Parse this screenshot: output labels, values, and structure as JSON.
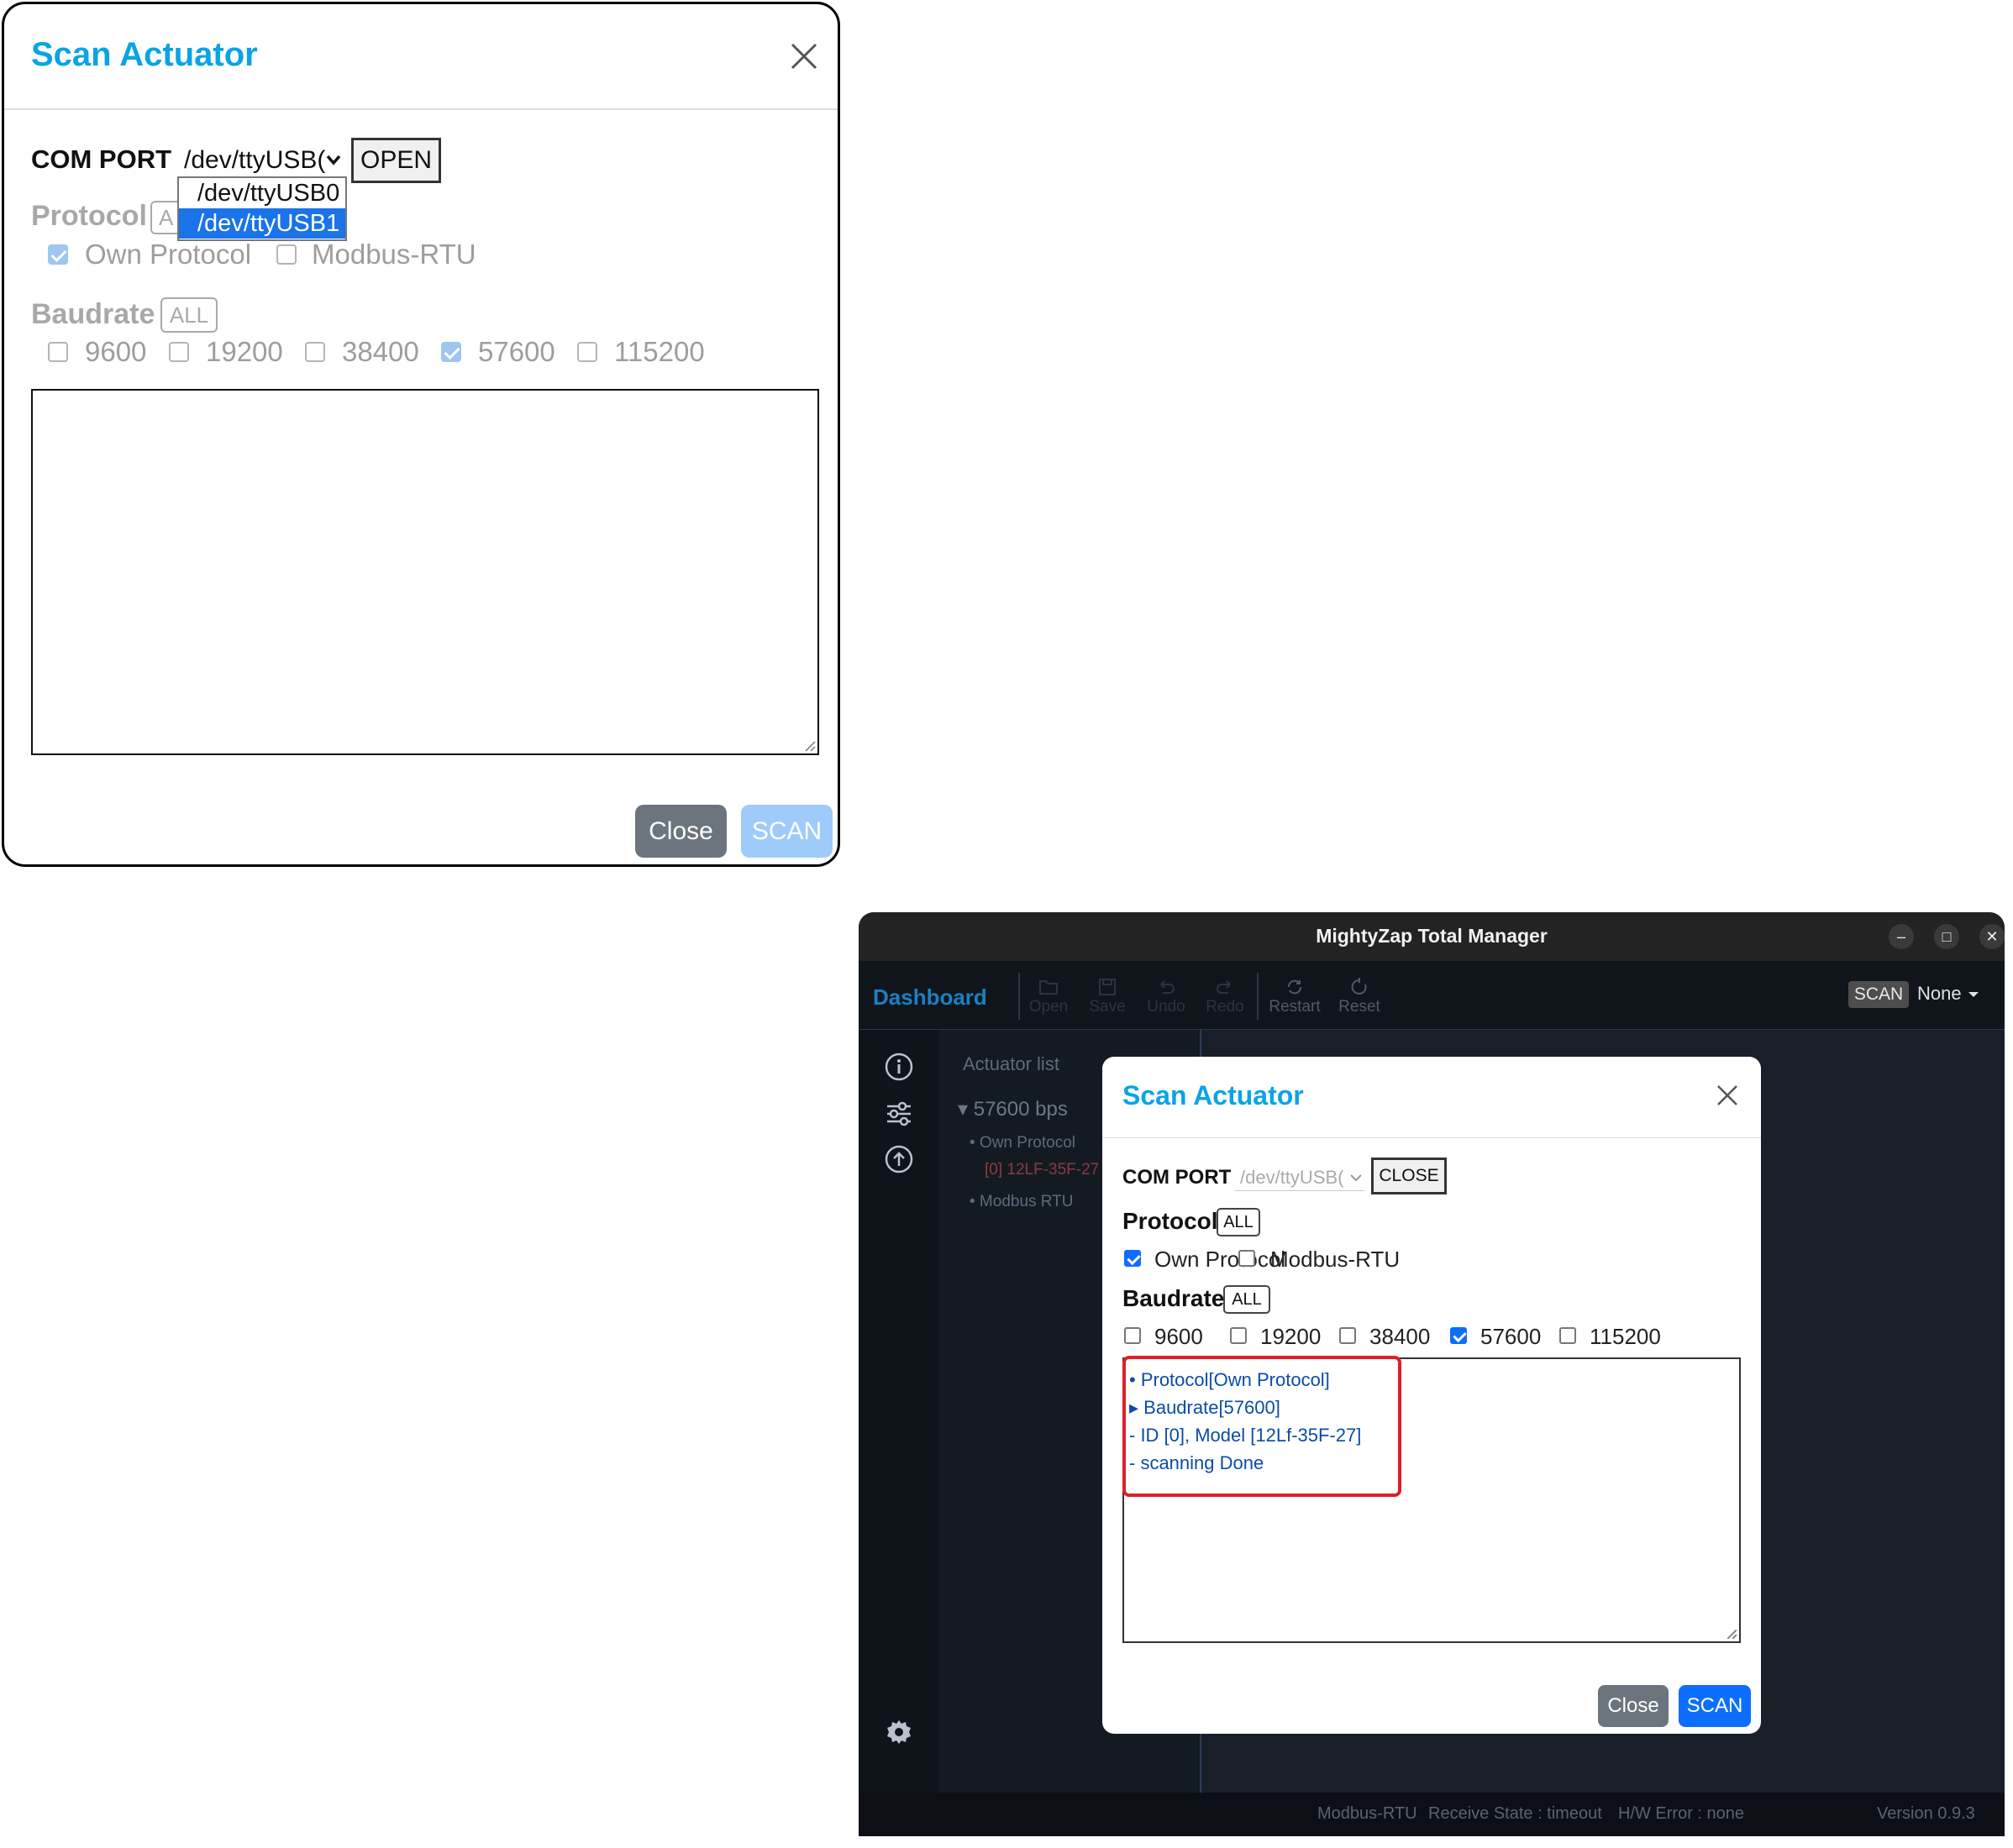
{
  "left_dialog": {
    "title": "Scan Actuator",
    "com_port_label": "COM PORT",
    "port_value": "/dev/ttyUSB(",
    "open_button": "OPEN",
    "dropdown_options": [
      "/dev/ttyUSB0",
      "/dev/ttyUSB1"
    ],
    "dropdown_selected": "/dev/ttyUSB1",
    "protocol_label": "Protocol",
    "protocol_all": "A",
    "protocol_options": [
      {
        "label": "Own Protocol",
        "checked": true
      },
      {
        "label": "Modbus-RTU",
        "checked": false
      }
    ],
    "baudrate_label": "Baudrate",
    "baudrate_all": "ALL",
    "baud_options": [
      {
        "label": "9600",
        "checked": false
      },
      {
        "label": "19200",
        "checked": false
      },
      {
        "label": "38400",
        "checked": false
      },
      {
        "label": "57600",
        "checked": true
      },
      {
        "label": "115200",
        "checked": false
      }
    ],
    "close_button": "Close",
    "scan_button": "SCAN"
  },
  "app": {
    "window_title": "MightyZap Total Manager",
    "window_controls": {
      "minimize": "–",
      "maximize": "□",
      "close": "✕"
    },
    "toolbar": {
      "dashboard": "Dashboard",
      "items": [
        "Open",
        "Save",
        "Undo",
        "Redo",
        "Restart",
        "Reset"
      ],
      "scan": "SCAN",
      "selected": "None"
    },
    "sidenav_icons": [
      "info-icon",
      "sliders-icon",
      "upload-icon",
      "settings-icon"
    ],
    "actuator_list": {
      "title": "Actuator list",
      "bps": "▾ 57600 bps",
      "own_protocol": "• Own Protocol",
      "item": "[0] 12LF-35F-27",
      "modbus": "• Modbus RTU"
    },
    "status": {
      "protocol": "Modbus-RTU",
      "receive_state": "Receive State : timeout",
      "hw_error": "H/W Error : none",
      "version": "Version 0.9.3"
    },
    "modal": {
      "title": "Scan Actuator",
      "com_port_label": "COM PORT",
      "port_value": "/dev/ttyUSB(",
      "close_port_button": "CLOSE",
      "protocol_label": "Protocol",
      "protocol_all": "ALL",
      "protocol_options": [
        {
          "label": "Own Protocol",
          "checked": true
        },
        {
          "label": "Modbus-RTU",
          "checked": false
        }
      ],
      "baudrate_label": "Baudrate",
      "baudrate_all": "ALL",
      "baud_options": [
        {
          "label": "9600",
          "checked": false
        },
        {
          "label": "19200",
          "checked": false
        },
        {
          "label": "38400",
          "checked": false
        },
        {
          "label": "57600",
          "checked": true
        },
        {
          "label": "115200",
          "checked": false
        }
      ],
      "log_lines": [
        "• Protocol[Own Protocol]",
        "▸ Baudrate[57600]",
        " - ID [0], Model [12Lf-35F-27]",
        " - scanning Done"
      ],
      "close_button": "Close",
      "scan_button": "SCAN"
    }
  },
  "colors": {
    "accent_title": "#0aa4e6",
    "primary": "#0d6efd",
    "secondary": "#6c757d",
    "highlight": "#e01e2a"
  }
}
